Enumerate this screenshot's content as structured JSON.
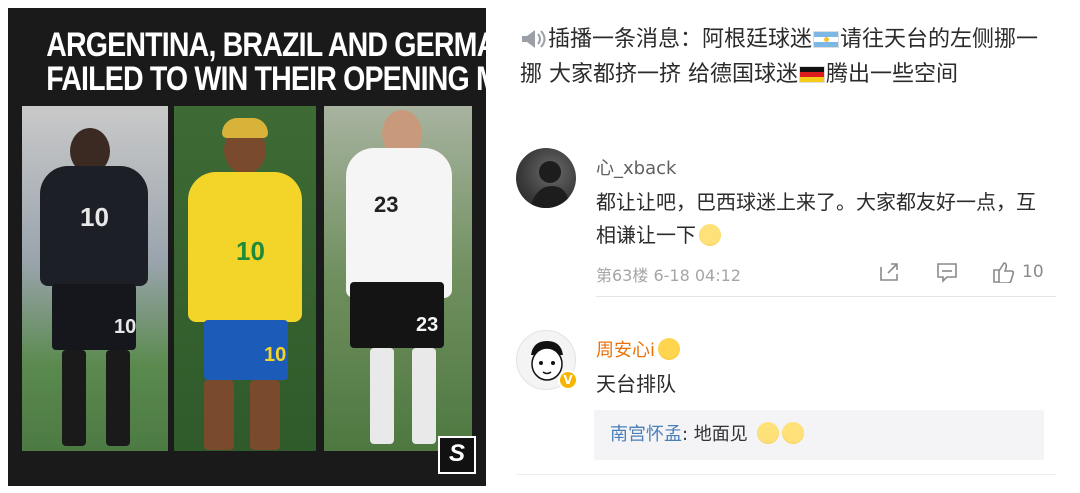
{
  "poster": {
    "headline_line1": "ARGENTINA, BRAZIL AND GERMANY ALL",
    "headline_line2": "FAILED TO WIN THEIR OPENING MATCH.",
    "players": [
      {
        "number": "10",
        "shorts_number": "10"
      },
      {
        "number": "10",
        "shorts_number": "10"
      },
      {
        "number": "23",
        "shorts_number": "23"
      }
    ],
    "brand_mark": "S"
  },
  "post": {
    "text_1": "插播一条消息：阿根廷球迷",
    "text_2": "请往天台的左侧挪一挪 大家都挤一挤 给德国球迷",
    "text_3": "腾出一些空间"
  },
  "comments": [
    {
      "username": "心_xback",
      "body": "都让让吧，巴西球迷上来了。大家都友好一点，互相谦让一下",
      "meta": "第63楼  6-18 04:12",
      "likes": "10"
    },
    {
      "username": "周安心i",
      "body": "天台排队",
      "reply_name": "南宫怀孟",
      "reply_text": ": 地面见"
    }
  ],
  "colors": {
    "username_orange": "#e8730c",
    "reply_link": "#4a7fb8",
    "meta_gray": "#a5a5a5"
  },
  "icons": [
    "speaker-icon",
    "argentina-flag-icon",
    "germany-flag-icon",
    "share-icon",
    "comment-icon",
    "like-icon",
    "vip-badge-icon"
  ]
}
